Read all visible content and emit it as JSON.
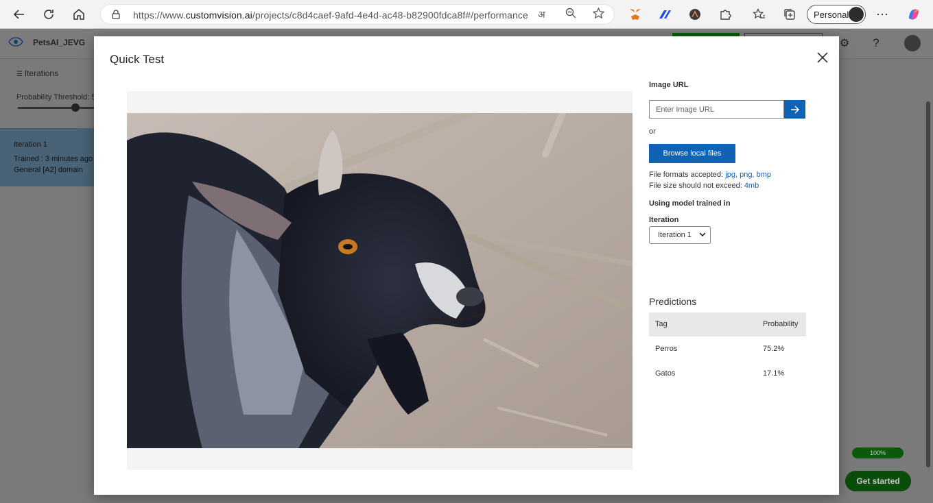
{
  "browser": {
    "url_prefix": "https://www.",
    "url_domain": "customvision.ai",
    "url_path": "/projects/c8d4caef-9afd-4e4d-ac48-b82900fdca8f#/performance",
    "profile_label": "Personal"
  },
  "app": {
    "project_name": "PetsAI_JEVG",
    "iterations_link": "Iterations",
    "threshold_label": "Probability Threshold: 5",
    "threshold_fraction": 0.7,
    "iteration_card": {
      "name": "Iteration 1",
      "trained": "Trained : 3 minutes ago",
      "domain": "General [A2] domain"
    },
    "progress_label": "100%",
    "get_started_label": "Get started"
  },
  "modal": {
    "title": "Quick Test",
    "image_url_label": "Image URL",
    "image_url_placeholder": "Enter Image URL",
    "or_label": "or",
    "browse_label": "Browse local files",
    "formats_prefix": "File formats accepted:",
    "formats": [
      "jpg,",
      "png,",
      "bmp"
    ],
    "size_prefix": "File size should not exceed:",
    "size_limit": "4mb",
    "model_label": "Using model trained in",
    "iteration_label": "Iteration",
    "iteration_selected": "Iteration 1",
    "predictions_title": "Predictions",
    "table": {
      "headers": [
        "Tag",
        "Probability"
      ],
      "rows": [
        {
          "tag": "Perros",
          "probability": "75.2%"
        },
        {
          "tag": "Gatos",
          "probability": "17.1%"
        }
      ]
    }
  },
  "colors": {
    "accent": "#0f62b4",
    "overlay": "#7a7a7a"
  }
}
